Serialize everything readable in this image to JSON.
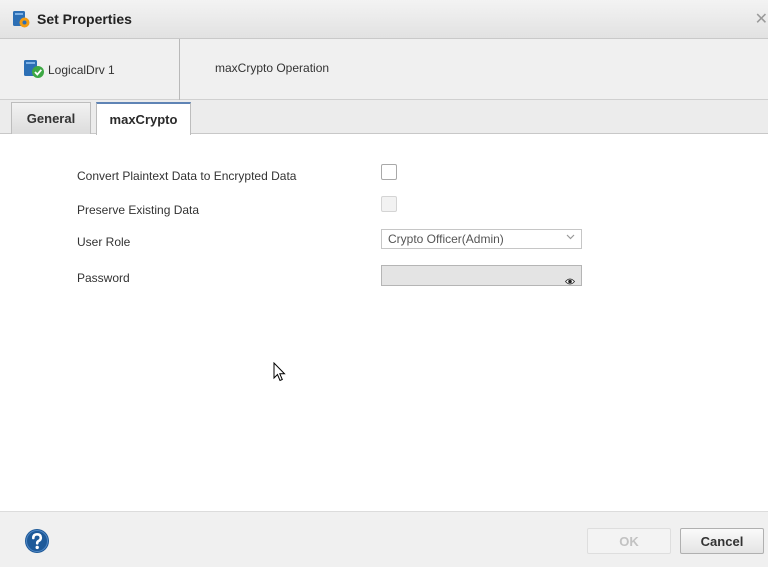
{
  "window": {
    "title": "Set Properties",
    "close_glyph": "✕"
  },
  "header": {
    "drive_name": "LogicalDrv 1",
    "operation_title": "maxCrypto Operation"
  },
  "tabs": [
    {
      "label": "General",
      "active": false
    },
    {
      "label": "maxCrypto",
      "active": true
    }
  ],
  "form": {
    "convert_label": "Convert Plaintext Data to Encrypted Data",
    "convert_checked": false,
    "preserve_label": "Preserve Existing Data",
    "preserve_checked": false,
    "preserve_enabled": false,
    "user_role_label": "User Role",
    "user_role_value": "Crypto Officer(Admin)",
    "password_label": "Password",
    "password_value": ""
  },
  "footer": {
    "ok_label": "OK",
    "cancel_label": "Cancel"
  },
  "icons": {
    "title": "drive-settings-icon",
    "drive": "logical-drive-ok-icon",
    "chevron": "chevron-down-icon",
    "eye": "eye-icon",
    "help": "help-icon",
    "close": "close-icon"
  },
  "colors": {
    "accent_blue": "#2c6fb5",
    "help_blue": "#1e5a99",
    "ok_green": "#3da844",
    "tab_active_border": "#5f84b5"
  }
}
